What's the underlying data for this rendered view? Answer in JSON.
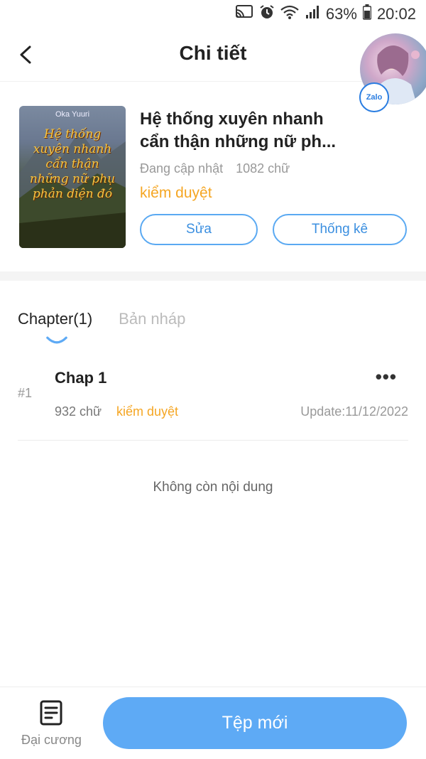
{
  "status_bar": {
    "battery": "63%",
    "time": "20:02"
  },
  "header": {
    "title": "Chi tiết"
  },
  "book": {
    "cover_author": "Oka Yuuri",
    "cover_title": "Hệ thống xuyên nhanh cẩn thận những nữ phụ phản diện đó",
    "title_line1": "Hệ thống xuyên nhanh",
    "title_line2": "cẩn thận những nữ ph...",
    "update_status": "Đang cập nhật",
    "word_count": "1082 chữ",
    "review_status": "kiểm duyệt",
    "edit_label": "Sửa",
    "stats_label": "Thống kê"
  },
  "tabs": [
    {
      "label": "Chapter(1)",
      "active": true
    },
    {
      "label": "Bản nháp",
      "active": false
    }
  ],
  "chapters": [
    {
      "index": "#1",
      "title": "Chap 1",
      "words": "932 chữ",
      "status": "kiểm duyệt",
      "updated": "Update:11/12/2022"
    }
  ],
  "empty_note": "Không còn nội dung",
  "bottom_bar": {
    "outline_label": "Đại cương",
    "new_file_label": "Tệp mới"
  },
  "floating_chat": {
    "badge": "Zalo"
  },
  "colors": {
    "accent_blue": "#5eaaf5",
    "review_orange": "#f5a623"
  }
}
